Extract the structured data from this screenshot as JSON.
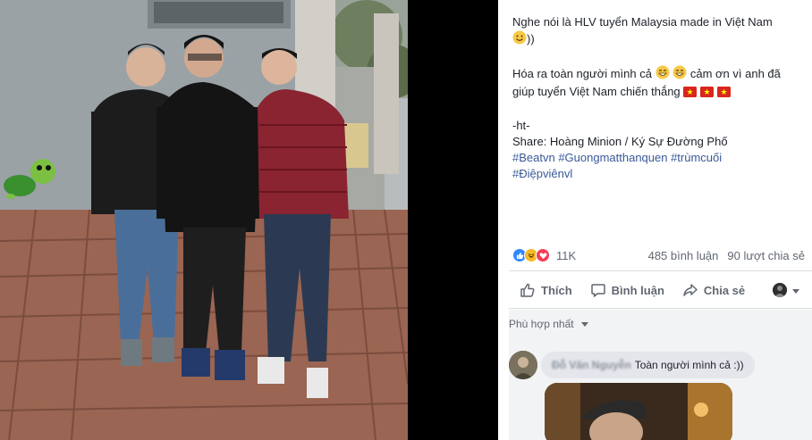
{
  "post": {
    "lines": [
      "Nghe nói là HLV tuyển Malaysia made in Việt Nam",
      "))",
      "Hóa ra toàn người mình cả",
      "cảm ơn vì anh đã",
      "giúp tuyển Việt Nam chiến thắng",
      "-ht-",
      "Share: Hoàng Minion / Ký Sự Đường Phố"
    ],
    "hashtags_line1": "#Beatvn #Guongmatthanquen #trùmcuối",
    "hashtags_line2": "#Điệpviênvl"
  },
  "stats": {
    "reactions_count": "11K",
    "comments": "485 bình luận",
    "shares": "90 lượt chia sẻ"
  },
  "actions": {
    "like": "Thích",
    "comment": "Bình luận",
    "share": "Chia sẻ"
  },
  "comments": {
    "sort_label": "Phù hợp nhất",
    "first": {
      "author": "Đỗ Văn Nguyễn",
      "text": "Toàn người mình cả :))"
    }
  },
  "colors": {
    "link": "#385898",
    "vn_flag_red": "#da251d",
    "vn_flag_star": "#ffff00",
    "like_blue": "#2d88ff",
    "love_red": "#f33e58",
    "haha_yellow": "#f7b928"
  }
}
